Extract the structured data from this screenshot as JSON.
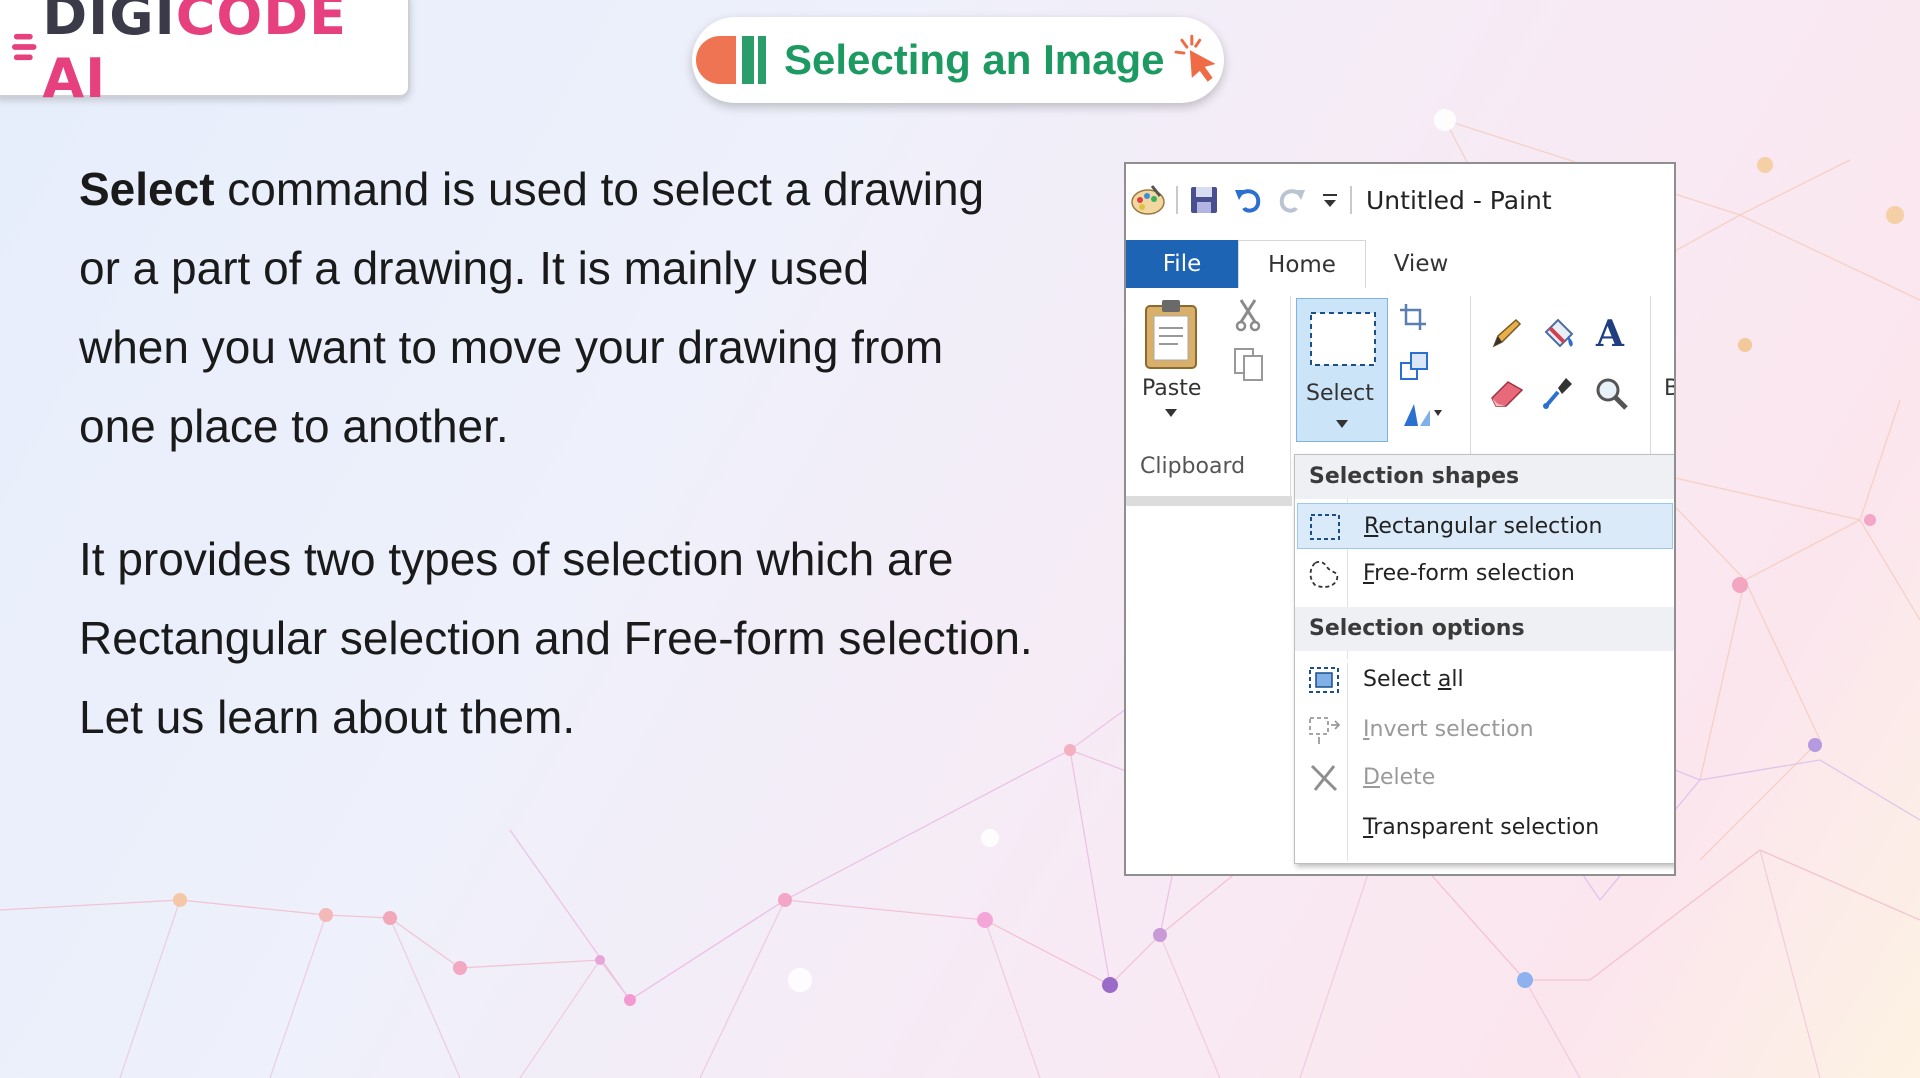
{
  "brand": {
    "logo_text_part1": "DIGI",
    "logo_text_part2": "CODE AI"
  },
  "header": {
    "title": "Selecting an Image"
  },
  "content": {
    "para1_bold": "Select",
    "para1_line1_rest": " command is used to select a drawing",
    "para1_line2": "or a part of a drawing. It is mainly used",
    "para1_line3": "when you want to move your drawing from",
    "para1_line4": "one place to another.",
    "para2_line1": "It provides two types of selection which are",
    "para2_line2": "Rectangular selection and Free-form selection.",
    "para2_line3": "Let us learn about them."
  },
  "paint": {
    "window_title": "Untitled - Paint",
    "tabs": [
      "File",
      "Home",
      "View"
    ],
    "ribbon": {
      "paste_label": "Paste",
      "select_label": "Select",
      "clipboard_group": "Clipboard",
      "cut_off_label": "B"
    },
    "menu": {
      "section1": "Selection shapes",
      "rectangular": {
        "first": "R",
        "rest": "ectangular selection"
      },
      "freeform": {
        "first": "F",
        "rest": "ree-form selection"
      },
      "section2": "Selection options",
      "select_all": {
        "pre": "Select ",
        "u": "a",
        "post": "ll"
      },
      "invert": {
        "first": "I",
        "rest": "nvert selection"
      },
      "delete": {
        "first": "D",
        "rest": "elete"
      },
      "transparent": {
        "first": "T",
        "rest": "ransparent selection"
      }
    }
  }
}
